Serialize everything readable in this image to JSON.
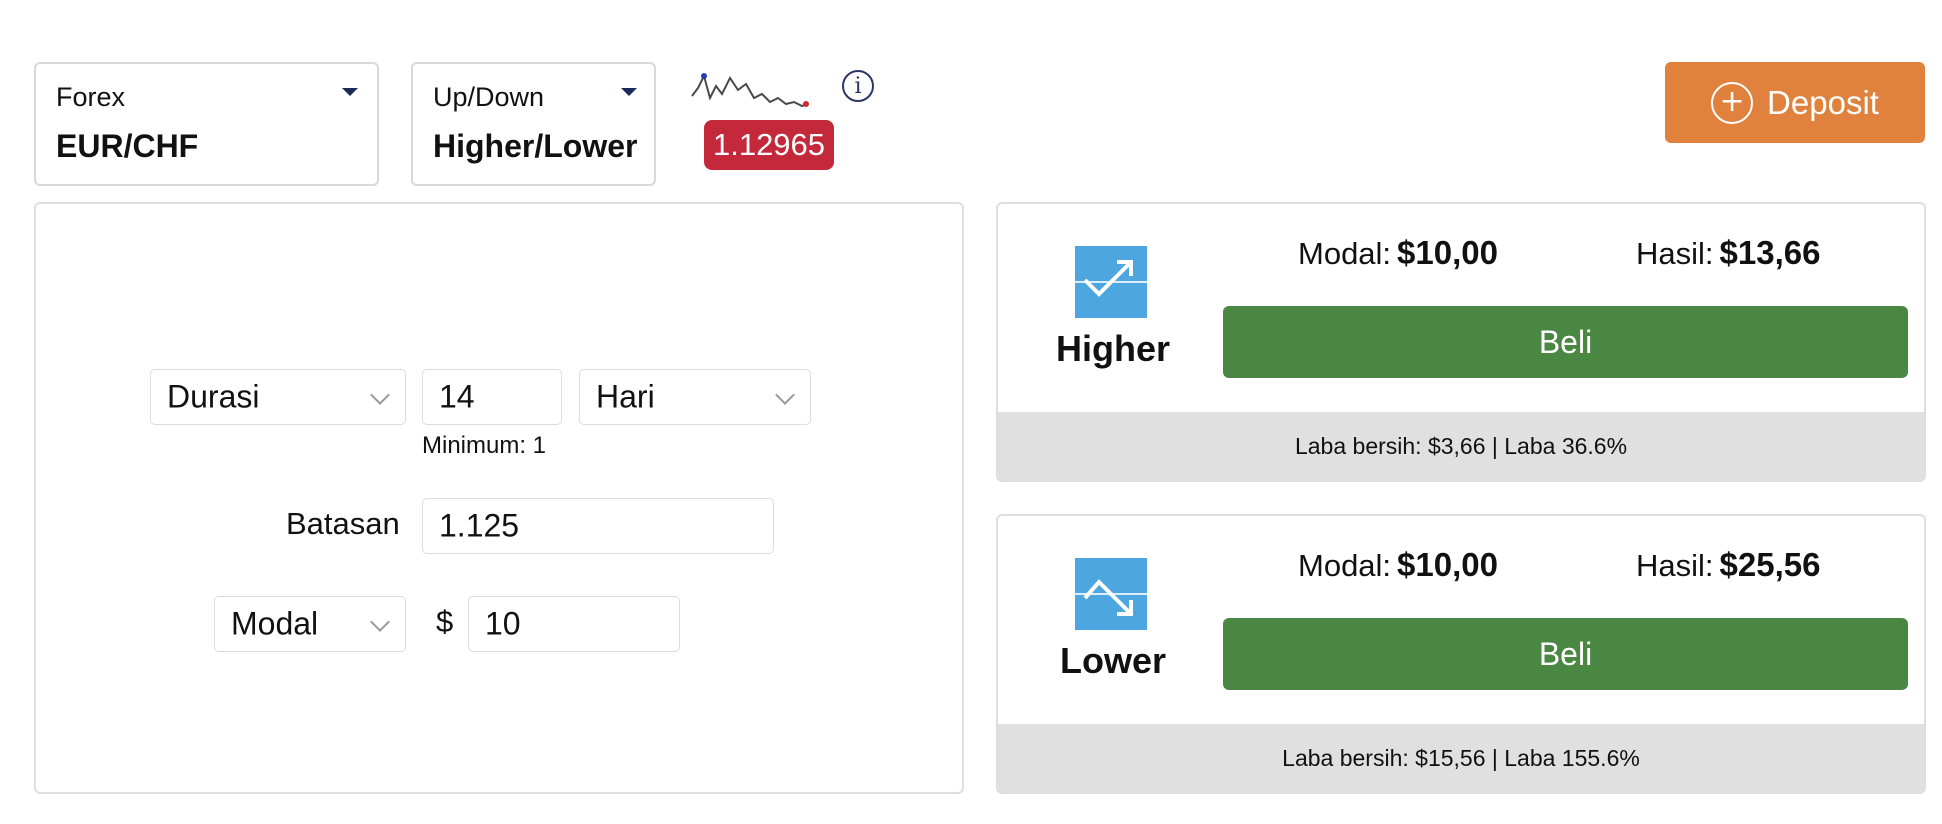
{
  "asset_selector": {
    "category": "Forex",
    "value": "EUR/CHF"
  },
  "type_selector": {
    "category": "Up/Down",
    "value": "Higher/Lower"
  },
  "price": {
    "value": "1.12965",
    "color": "#c4283b"
  },
  "info_icon": "info-circle-icon",
  "deposit": {
    "label": "Deposit",
    "color": "#e0823d"
  },
  "form": {
    "duration_select": "Durasi",
    "duration_value": "14",
    "duration_unit": "Hari",
    "duration_hint": "Minimum: 1",
    "limit_label": "Batasan",
    "limit_value": "1.125",
    "stake_select": "Modal",
    "currency": "$",
    "stake_value": "10"
  },
  "options": [
    {
      "direction": "Higher",
      "modal_label": "Modal:",
      "modal_value": "$10,00",
      "result_label": "Hasil:",
      "result_value": "$13,66",
      "buy_label": "Beli",
      "footer": "Laba bersih: $3,66 | Laba 36.6%"
    },
    {
      "direction": "Lower",
      "modal_label": "Modal:",
      "modal_value": "$10,00",
      "result_label": "Hasil:",
      "result_value": "$25,56",
      "buy_label": "Beli",
      "footer": "Laba bersih: $15,56 | Laba 155.6%"
    }
  ],
  "colors": {
    "buy": "#4a8743",
    "icon": "#4ea6e0",
    "footer_bg": "#e0e0e0"
  }
}
